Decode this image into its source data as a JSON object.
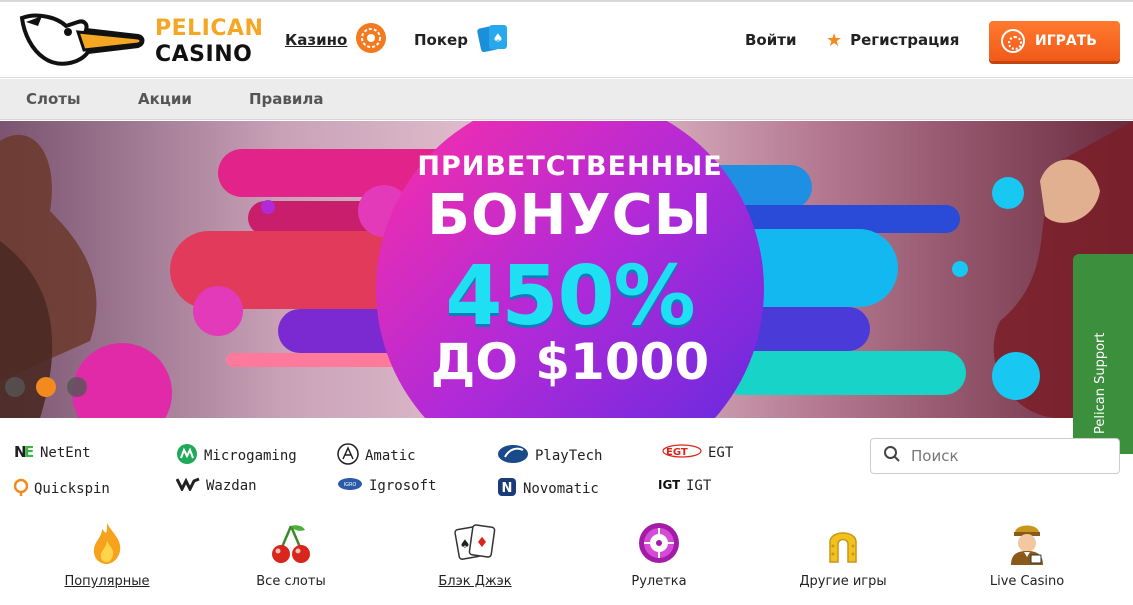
{
  "brand": {
    "line1": "PELICAN",
    "line2": "CASINO"
  },
  "top_nav": {
    "casino": "Казино",
    "poker": "Покер"
  },
  "auth": {
    "login": "Войти",
    "register": "Регистрация",
    "play": "ИГРАТЬ"
  },
  "sub_nav": [
    "Слоты",
    "Акции",
    "Правила"
  ],
  "banner": {
    "line1": "ПРИВЕТСТВЕННЫЕ",
    "line2": "БОНУСЫ",
    "line3": "450%",
    "line4": "ДО $1000",
    "slides": 3,
    "active_slide": 2
  },
  "support": "Pelican Support",
  "providers": [
    [
      "NetEnt",
      "Microgaming",
      "Amatic",
      "PlayTech",
      "EGT"
    ],
    [
      "Quickspin",
      "Wazdan",
      "Igrosoft",
      "Novomatic",
      "IGT"
    ]
  ],
  "search": {
    "placeholder": "Поиск"
  },
  "categories": [
    "Популярные",
    "Все слоты",
    "Блэк Джэк",
    "Рулетка",
    "Другие игры",
    "Live Casino"
  ],
  "colors": {
    "accent": "#f28a1e",
    "support": "#3c8f3c",
    "banner_cyan": "#1ee0f2"
  }
}
